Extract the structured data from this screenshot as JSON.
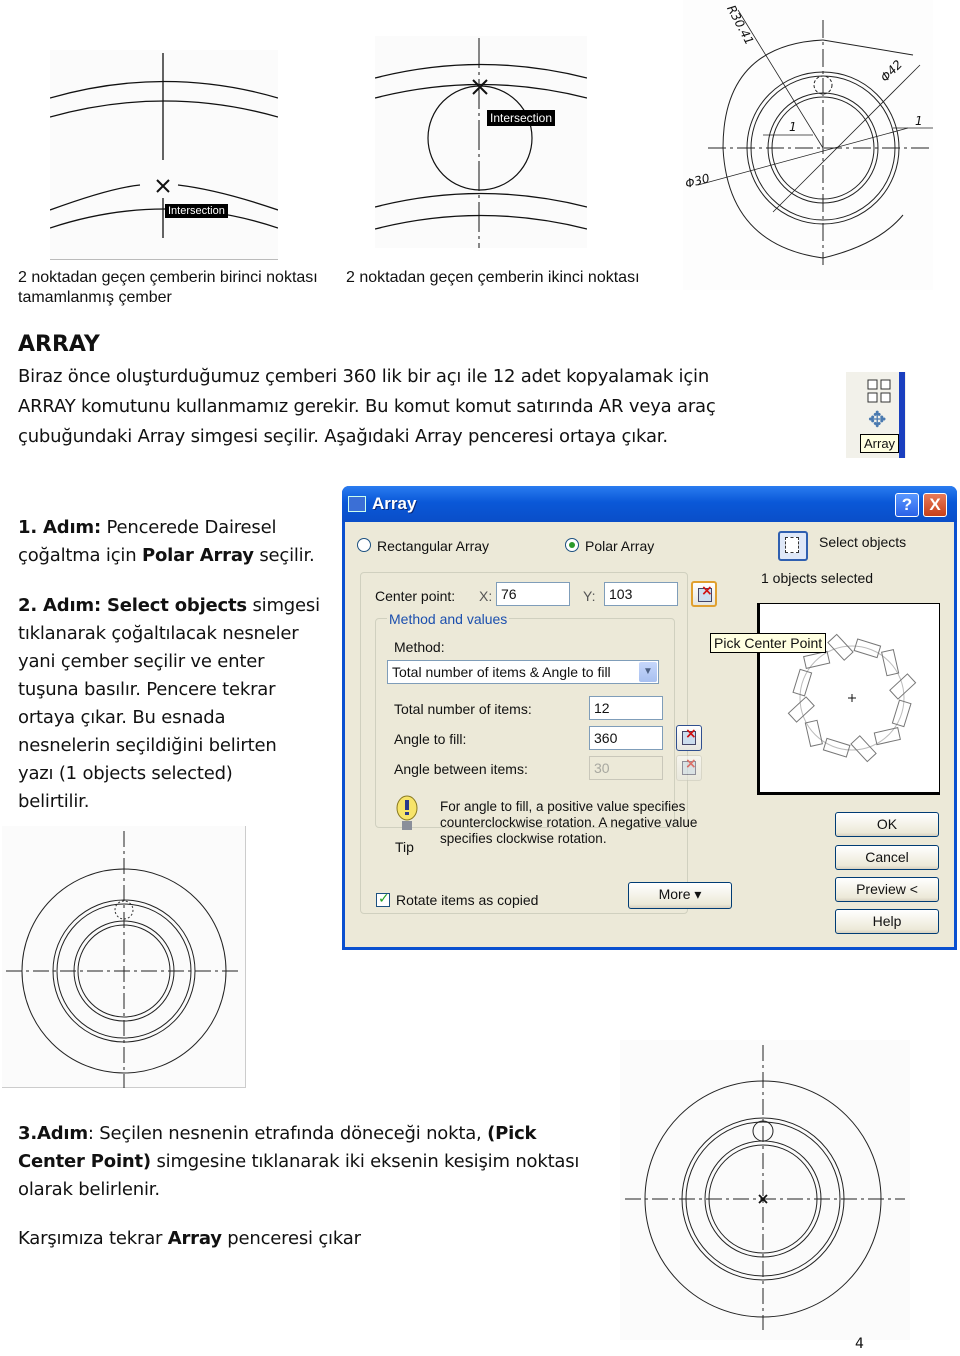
{
  "figures": {
    "fig1": {
      "tooltip": "Intersection",
      "caption_line1": "2 noktadan geçen çemberin birinci noktası",
      "caption_line2": "tamamlanmış çember"
    },
    "fig2": {
      "tooltip": "Intersection",
      "caption": "2 noktadan geçen çemberin ikinci noktası"
    },
    "fig3": {
      "dim_radius": "R30.41",
      "dim_dia42": "Φ42",
      "dim_dia30": "Φ30",
      "dim_one_a": "1",
      "dim_one_b": "1"
    }
  },
  "section": {
    "heading": "ARRAY",
    "para_line1": "Biraz önce oluşturduğumuz çemberi 360 lik bir açı ile 12 adet kopyalamak için",
    "para_line2": "ARRAY komutunu kullanmamız gerekir. Bu komut komut satırında AR veya araç",
    "para_line3": "çubuğundaki Array simgesi seçilir. Aşağıdaki Array penceresi ortaya çıkar.",
    "toolbar_tooltip": "Array"
  },
  "steps": {
    "step1_label": "1. Adım:",
    "step1_text_a": " Pencerede Dairesel",
    "step1_text_b": "çoğaltma için ",
    "step1_bold": "Polar Array",
    "step1_text_c": " seçilir.",
    "step2_label": "2. Adım:",
    "step2_bold": " Select objects",
    "step2_lines": [
      " simgesi",
      "tıklanarak çoğaltılacak nesneler",
      "yani çember  seçilir ve enter",
      "tuşuna basılır. Pencere tekrar",
      "ortaya çıkar. Bu esnada",
      "nesnelerin seçildiğini belirten",
      "yazı (1 objects selected)",
      "belirtilir."
    ],
    "step3_label": "3.Adım",
    "step3_line1": ": Seçilen nesnenin etrafında döneceği nokta, ",
    "step3_bold1": "(Pick",
    "step3_bold2": "Center Point)",
    "step3_line2": " simgesine tıklanarak iki eksenin kesişim noktası",
    "step3_line3": "olarak belirlenir.",
    "final_a": "Karşımıza tekrar ",
    "final_bold": "Array",
    "final_b": " penceresi çıkar"
  },
  "dialog": {
    "title": "Array",
    "help_label": "?",
    "close_label": "X",
    "rect_array_label": "Rectangular Array",
    "polar_array_label": "Polar Array",
    "polar_selected": true,
    "select_objects_label": "Select objects",
    "objects_selected": "1 objects selected",
    "center_point_label": "Center point:",
    "x_label": "X:",
    "x_value": "76",
    "y_label": "Y:",
    "y_value": "103",
    "pick_tooltip": "Pick Center Point",
    "method_group_label": "Method and values",
    "method_label": "Method:",
    "method_value": "Total number of items & Angle to fill",
    "total_items_label": "Total number of items:",
    "total_items_value": "12",
    "angle_fill_label": "Angle to fill:",
    "angle_fill_value": "360",
    "angle_between_label": "Angle between items:",
    "angle_between_value": "30",
    "tip_label": "Tip",
    "tip_text": "For angle to fill, a positive value specifies counterclockwise rotation.  A negative value specifies clockwise rotation.",
    "rotate_label": "Rotate items as copied",
    "rotate_checked": true,
    "more_label": "More  ▾",
    "ok_label": "OK",
    "cancel_label": "Cancel",
    "preview_label": "Preview <",
    "help_button_label": "Help"
  },
  "page_number": "4"
}
